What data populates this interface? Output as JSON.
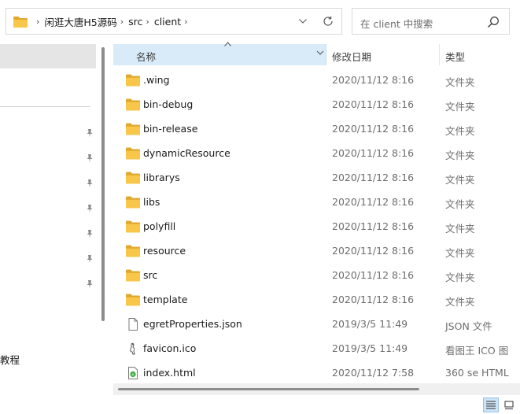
{
  "address_bar": {
    "crumbs": [
      "闲逛大唐H5源码",
      "src",
      "client"
    ]
  },
  "search": {
    "placeholder": "在 client 中搜索"
  },
  "nav_pane": {
    "visible_label": "教程"
  },
  "columns": {
    "name": "名称",
    "date": "修改日期",
    "type": "类型"
  },
  "files": [
    {
      "name": ".wing",
      "date": "2020/11/12 8:16",
      "type": "文件夹",
      "icon": "folder-icon"
    },
    {
      "name": "bin-debug",
      "date": "2020/11/12 8:16",
      "type": "文件夹",
      "icon": "folder-icon"
    },
    {
      "name": "bin-release",
      "date": "2020/11/12 8:16",
      "type": "文件夹",
      "icon": "folder-icon"
    },
    {
      "name": "dynamicResource",
      "date": "2020/11/12 8:16",
      "type": "文件夹",
      "icon": "folder-icon"
    },
    {
      "name": "librarys",
      "date": "2020/11/12 8:16",
      "type": "文件夹",
      "icon": "folder-icon"
    },
    {
      "name": "libs",
      "date": "2020/11/12 8:16",
      "type": "文件夹",
      "icon": "folder-icon"
    },
    {
      "name": "polyfill",
      "date": "2020/11/12 8:16",
      "type": "文件夹",
      "icon": "folder-icon"
    },
    {
      "name": "resource",
      "date": "2020/11/12 8:16",
      "type": "文件夹",
      "icon": "folder-icon"
    },
    {
      "name": "src",
      "date": "2020/11/12 8:16",
      "type": "文件夹",
      "icon": "folder-icon"
    },
    {
      "name": "template",
      "date": "2020/11/12 8:16",
      "type": "文件夹",
      "icon": "folder-icon"
    },
    {
      "name": "egretProperties.json",
      "date": "2019/3/5 11:49",
      "type": "JSON 文件",
      "icon": "file-icon"
    },
    {
      "name": "favicon.ico",
      "date": "2019/3/5 11:49",
      "type": "看图王 ICO 图",
      "icon": "ico-file-icon"
    },
    {
      "name": "index.html",
      "date": "2020/11/12 7:58",
      "type": "360 se HTML",
      "icon": "html-file-icon"
    }
  ],
  "colors": {
    "folder": "#f8c74a",
    "header_selected": "#d9ebf9",
    "nav_selected": "#e5e5e5",
    "secondary_text": "#6d6d6d"
  }
}
